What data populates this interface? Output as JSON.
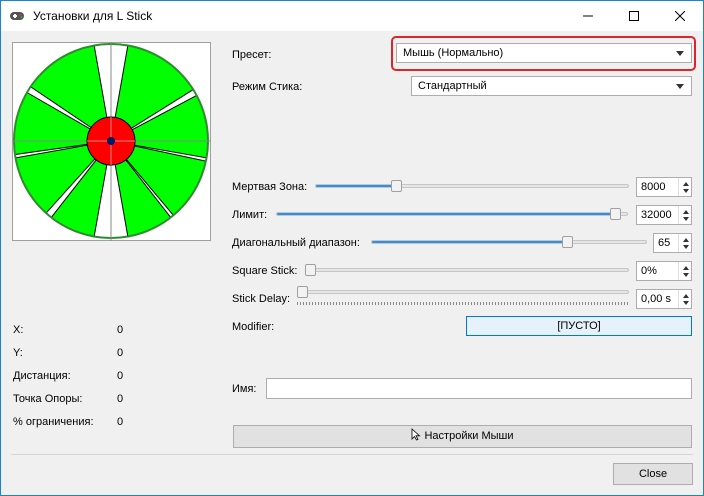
{
  "window": {
    "title": "Установки для L Stick"
  },
  "preset": {
    "label": "Пресет:",
    "value": "Мышь (Нормально)"
  },
  "stick_mode": {
    "label": "Режим Стика:",
    "value": "Стандартный"
  },
  "sliders": {
    "deadzone": {
      "label": "Мертвая Зона:",
      "value": "8000",
      "fraction": 0.25
    },
    "limit": {
      "label": "Лимит:",
      "value": "32000",
      "fraction": 0.98
    },
    "diagonal": {
      "label": "Диагональный диапазон:",
      "value": "65",
      "fraction": 0.72
    },
    "square": {
      "label": "Square Stick:",
      "value": "0%",
      "fraction": 0.0
    },
    "delay": {
      "label": "Stick Delay:",
      "value": "0,00 s",
      "fraction": 0.0
    }
  },
  "modifier": {
    "label": "Modifier:",
    "button": "[ПУСТО]"
  },
  "name": {
    "label": "Имя:",
    "value": ""
  },
  "mouse_settings_button": "Настройки Мыши",
  "close_button": "Close",
  "stats": {
    "x": {
      "label": "X:",
      "value": "0"
    },
    "y": {
      "label": "Y:",
      "value": "0"
    },
    "distance": {
      "label": "Дистанция:",
      "value": "0"
    },
    "anchor": {
      "label": "Точка Опоры:",
      "value": "0"
    },
    "limit_pct": {
      "label": "% ограничения:",
      "value": "0"
    }
  },
  "colors": {
    "zone": "#00ff00",
    "deadzone": "#ff0000",
    "accent": "#2f8fe4",
    "highlight": "#d9262c"
  }
}
